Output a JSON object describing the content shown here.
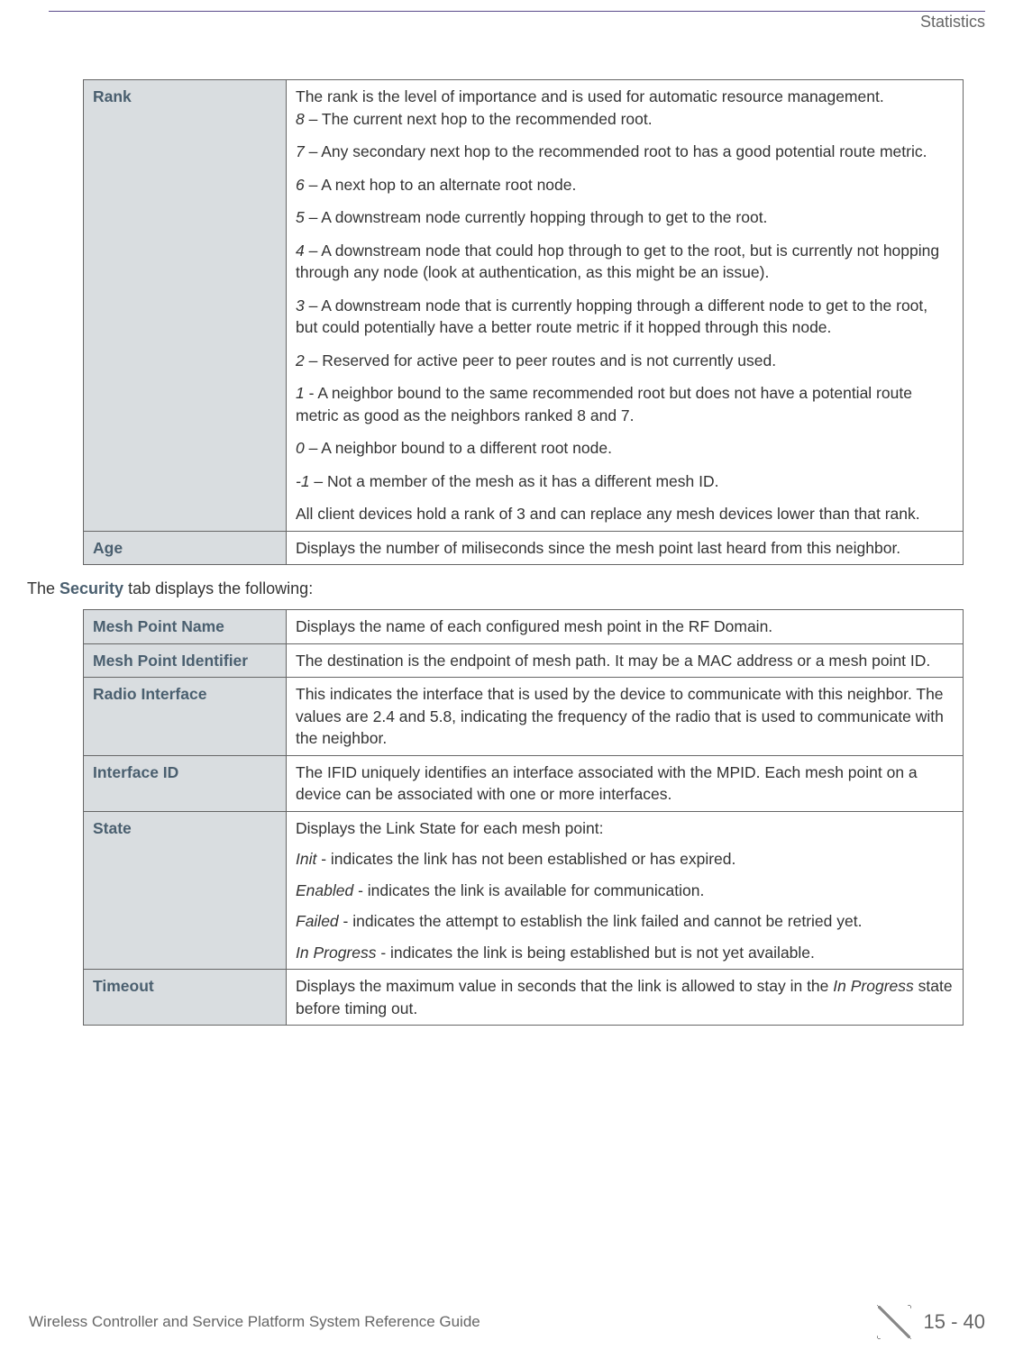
{
  "header": {
    "section": "Statistics"
  },
  "table1": {
    "rank": {
      "label": "Rank",
      "intro": "The rank is the level of importance and is used for automatic resource management.",
      "items": [
        {
          "num": "8",
          "sep": " – ",
          "text": "The current next hop to the recommended root."
        },
        {
          "num": "7",
          "sep": " – ",
          "text": "Any secondary next hop to the recommended root to has a good potential route metric."
        },
        {
          "num": "6",
          "sep": " – ",
          "text": "A next hop to an alternate root node."
        },
        {
          "num": "5",
          "sep": " – ",
          "text": "A downstream node currently hopping through to get to the root."
        },
        {
          "num": "4",
          "sep": " – ",
          "text": "A downstream node that could hop through to get to the root, but is currently not hopping through any node (look at authentication, as this might be an issue)."
        },
        {
          "num": "3",
          "sep": " – ",
          "text": "A downstream node that is currently hopping through a different node to get to the root, but could potentially have a better route metric if it hopped through this node."
        },
        {
          "num": "2",
          "sep": " – ",
          "text": "Reserved for active peer to peer routes and is not currently used."
        },
        {
          "num": "1",
          "sep": " - ",
          "text": "A neighbor bound to the same recommended root but does not have a potential route metric as good as the neighbors ranked 8 and 7."
        },
        {
          "num": "0",
          "sep": " – ",
          "text": "A neighbor bound to a different root node."
        },
        {
          "num": "-1",
          "sep": " – ",
          "text": "Not a member of the mesh as it has a different mesh ID."
        }
      ],
      "outro": "All client devices hold a rank of 3 and can replace any mesh devices lower than that rank."
    },
    "age": {
      "label": "Age",
      "desc": "Displays the number of miliseconds since the mesh point last heard from this neighbor."
    }
  },
  "intro": {
    "prefix": "The ",
    "bold": "Security",
    "suffix": " tab displays the following:"
  },
  "table2": {
    "rows": [
      {
        "label": "Mesh Point Name",
        "desc": "Displays the name of each configured mesh point in the RF Domain."
      },
      {
        "label": "Mesh Point Identifier",
        "desc": "The destination is the endpoint of mesh path. It may be a MAC address or a mesh point ID."
      },
      {
        "label": "Radio Interface",
        "desc": "This indicates the interface that is used by the device to communicate with this neighbor. The values are 2.4 and 5.8, indicating the frequency of the radio that is used to communicate with the neighbor."
      },
      {
        "label": "Interface ID",
        "desc": "The IFID uniquely identifies an interface associated with the MPID. Each mesh point on a device can be associated with one or more interfaces."
      }
    ],
    "state": {
      "label": "State",
      "intro": "Displays the Link State for each mesh point:",
      "items": [
        {
          "name": "Init",
          "sep": " - ",
          "text": "indicates the link has not been established or has expired."
        },
        {
          "name": "Enabled",
          "sep": " - ",
          "text": "indicates the link is available for communication."
        },
        {
          "name": "Failed",
          "sep": " - ",
          "text": "indicates the attempt to establish the link failed and cannot be retried yet."
        },
        {
          "name": "In Progress",
          "sep": " - ",
          "text": "indicates the link is being established but is not yet available."
        }
      ]
    },
    "timeout": {
      "label": "Timeout",
      "prefix": "Displays the maximum value in seconds that the link is allowed to stay in the ",
      "italic": "In Progress",
      "suffix": " state before timing out."
    }
  },
  "footer": {
    "left": "Wireless Controller and Service Platform System Reference Guide",
    "right": "15 - 40"
  }
}
